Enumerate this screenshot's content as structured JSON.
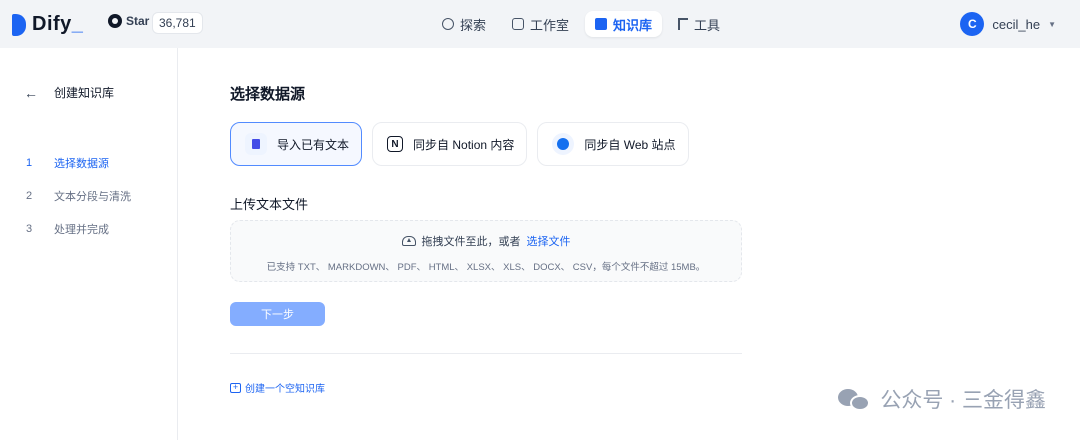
{
  "brand": {
    "name": "Dify",
    "suffix": "_"
  },
  "github": {
    "label": "Star",
    "count": "36,781"
  },
  "nav": [
    {
      "label": "探索",
      "icon": "explore-icon"
    },
    {
      "label": "工作室",
      "icon": "studio-icon"
    },
    {
      "label": "知识库",
      "icon": "book-icon",
      "active": true
    },
    {
      "label": "工具",
      "icon": "tool-icon"
    }
  ],
  "user": {
    "initial": "C",
    "name": "cecil_he"
  },
  "sidebar": {
    "back_label": "创建知识库",
    "steps": [
      {
        "num": "1",
        "label": "选择数据源",
        "active": true
      },
      {
        "num": "2",
        "label": "文本分段与清洗"
      },
      {
        "num": "3",
        "label": "处理并完成"
      }
    ]
  },
  "main": {
    "title": "选择数据源",
    "sources": [
      {
        "label": "导入已有文本",
        "icon": "file-icon",
        "active": true
      },
      {
        "label": "同步自 Notion 内容",
        "icon": "notion-icon"
      },
      {
        "label": "同步自 Web 站点",
        "icon": "web-icon"
      }
    ],
    "upload_title": "上传文本文件",
    "upload": {
      "drag_text": "拖拽文件至此，或者",
      "choose_text": "选择文件",
      "support_text": "已支持 TXT、 MARKDOWN、 PDF、 HTML、 XLSX、 XLS、 DOCX、 CSV，每个文件不超过 15MB。"
    },
    "next_label": "下一步",
    "create_empty_label": "创建一个空知识库"
  },
  "watermark": "公众号 · 三金得鑫",
  "colors": {
    "accent": "#1c64f2",
    "button_disabled": "#84adff"
  }
}
